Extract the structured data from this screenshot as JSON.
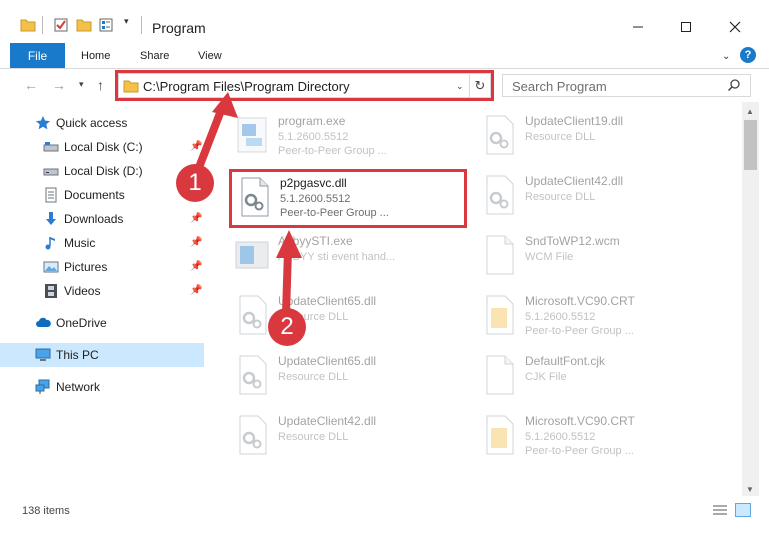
{
  "window": {
    "title": "Program",
    "minimize_icon": "minimize-icon",
    "maximize_icon": "maximize-icon",
    "close_icon": "close-icon"
  },
  "ribbon": {
    "file": "File",
    "home": "Home",
    "share": "Share",
    "view": "View"
  },
  "address": {
    "path": "C:\\Program Files\\Program Directory"
  },
  "search": {
    "placeholder": "Search Program"
  },
  "sidebar": {
    "quick_access": "Quick access",
    "local_c": "Local Disk (C:)",
    "local_d": "Local Disk (D:)",
    "documents": "Documents",
    "downloads": "Downloads",
    "music": "Music",
    "pictures": "Pictures",
    "videos": "Videos",
    "onedrive": "OneDrive",
    "this_pc": "This PC",
    "network": "Network"
  },
  "files": {
    "program_exe": {
      "name": "program.exe",
      "l2": "5.1.2600.5512",
      "l3": "Peer-to-Peer Group ..."
    },
    "p2pgasvc": {
      "name": "p2pgasvc.dll",
      "l2": "5.1.2600.5512",
      "l3": "Peer-to-Peer Group ..."
    },
    "abbyy": {
      "name": "AbbyySTI.exe",
      "l2": "ABBYY sti event hand..."
    },
    "uc65a": {
      "name": "UpdateClient65.dll",
      "l2": "Resource DLL"
    },
    "uc65b": {
      "name": "UpdateClient65.dll",
      "l2": "Resource DLL"
    },
    "uc42a": {
      "name": "UpdateClient42.dll",
      "l2": "Resource DLL"
    },
    "uc19": {
      "name": "UpdateClient19.dll",
      "l2": "Resource DLL"
    },
    "uc42b": {
      "name": "UpdateClient42.dll",
      "l2": "Resource DLL"
    },
    "sndtowp": {
      "name": "SndToWP12.wcm",
      "l2": "WCM File"
    },
    "vc90a": {
      "name": "Microsoft.VC90.CRT",
      "l2": "5.1.2600.5512",
      "l3": "Peer-to-Peer Group ..."
    },
    "defaultfont": {
      "name": "DefaultFont.cjk",
      "l2": "CJK File"
    },
    "vc90b": {
      "name": "Microsoft.VC90.CRT",
      "l2": "5.1.2600.5512",
      "l3": "Peer-to-Peer Group ..."
    }
  },
  "status": {
    "items": "138 items"
  },
  "callouts": {
    "one": "1",
    "two": "2"
  },
  "colors": {
    "accent": "#1979ca",
    "annotation_red": "#d9383f",
    "selection": "#cce8ff"
  }
}
